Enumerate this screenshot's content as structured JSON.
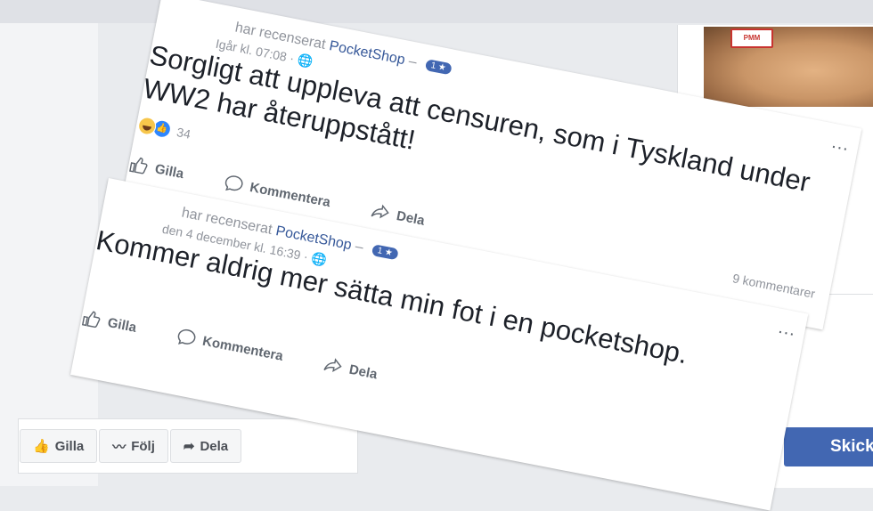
{
  "background": {
    "photo_badge": "PMM",
    "action_bar": [
      {
        "label": "Gilla",
        "icon": "thumbs-up-icon"
      },
      {
        "label": "Följ",
        "icon": "rss-icon"
      },
      {
        "label": "Dela",
        "icon": "share-arrow-icon"
      }
    ],
    "send_label": "Skicka"
  },
  "reviews": [
    {
      "reviewed_label": "har recenserat",
      "page_name": "PocketShop",
      "separator": "–",
      "rating_badge": "1 ★",
      "timestamp": "Igår kl. 07:08 ·",
      "text": "Sorgligt att uppleva att censuren, som i Tyskland under WW2 har återuppstått!",
      "reaction_count": "34",
      "like_label": "Gilla",
      "comment_label": "Kommentera",
      "share_label": "Dela",
      "comments_count": "9 kommentarer",
      "more": "..."
    },
    {
      "reviewed_label": "har recenserat",
      "page_name": "PocketShop",
      "separator": "–",
      "rating_badge": "1 ★",
      "timestamp": "den 4 december kl. 16:39 ·",
      "text": "Kommer aldrig mer sätta min fot i en pocketshop.",
      "like_label": "Gilla",
      "comment_label": "Kommentera",
      "share_label": "Dela",
      "more": "..."
    }
  ],
  "colors": {
    "link": "#365899",
    "badge": "#4267b2",
    "meta_text": "#90949c",
    "body_text": "#1d2129"
  }
}
